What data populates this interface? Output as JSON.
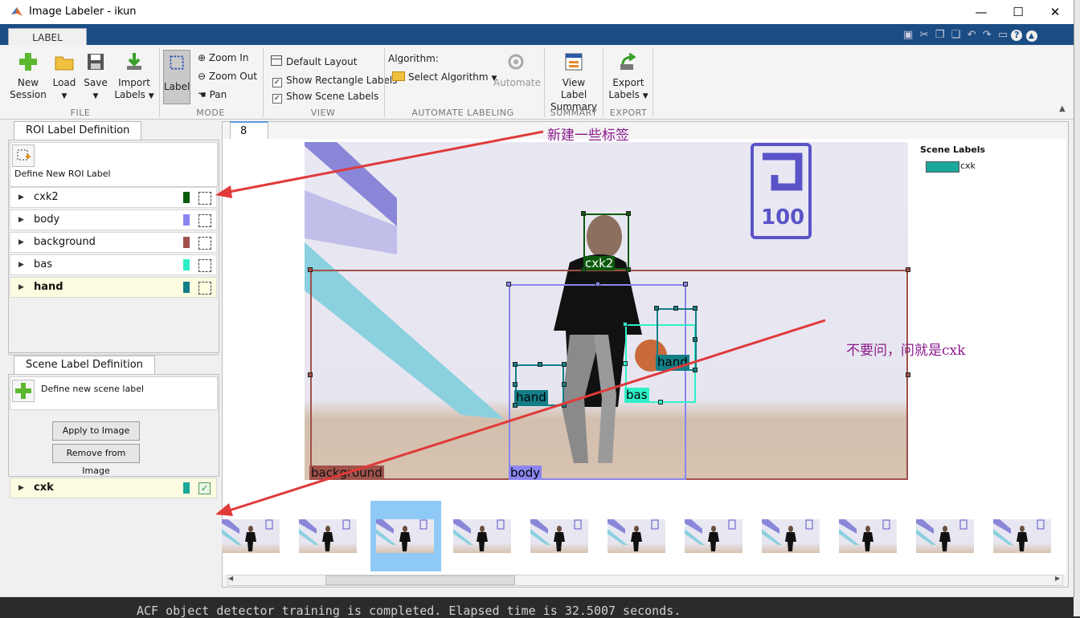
{
  "window": {
    "title": "Image Labeler - ikun",
    "minimize": "—",
    "maximize": "☐",
    "close": "✕"
  },
  "ribbon": {
    "tab": "LABEL",
    "file": {
      "group": "FILE",
      "new_session": [
        "New",
        "Session"
      ],
      "load": "Load",
      "save": "Save",
      "import_labels": [
        "Import",
        "Labels"
      ]
    },
    "mode": {
      "group": "MODE",
      "label": "Label",
      "zoom_in": "Zoom In",
      "zoom_out": "Zoom Out",
      "pan": "Pan"
    },
    "view": {
      "group": "VIEW",
      "default_layout": "Default Layout",
      "show_rect_labels": "Show Rectangle Labels",
      "show_rect_labels_checked": true,
      "show_scene_labels": "Show Scene Labels",
      "show_scene_labels_checked": true
    },
    "automate": {
      "group": "AUTOMATE LABELING",
      "algorithm_label": "Algorithm:",
      "select_algorithm": "Select Algorithm",
      "automate": "Automate"
    },
    "summary": {
      "group": "SUMMARY",
      "view_label_summary": [
        "View Label",
        "Summary"
      ]
    },
    "export": {
      "group": "EXPORT",
      "export_labels": [
        "Export",
        "Labels"
      ]
    }
  },
  "roi_panel": {
    "tab": "ROI Label Definition",
    "define_new": "Define New ROI Label",
    "labels": [
      {
        "name": "cxk2",
        "color": "#0b5a0b",
        "selected": false
      },
      {
        "name": "body",
        "color": "#8a86f0",
        "selected": false
      },
      {
        "name": "background",
        "color": "#a0524a",
        "selected": false
      },
      {
        "name": "bas",
        "color": "#2ef0c8",
        "selected": false
      },
      {
        "name": "hand",
        "color": "#137e86",
        "selected": true
      }
    ]
  },
  "scene_panel": {
    "tab": "Scene Label Definition",
    "define_new": "Define new scene label",
    "apply": "Apply to Image",
    "remove": "Remove from Image",
    "labels": [
      {
        "name": "cxk",
        "color": "#1aa89a",
        "checked": true
      }
    ]
  },
  "image_tab": "8",
  "scene_labels_legend": {
    "title": "Scene Labels",
    "items": [
      {
        "name": "cxk",
        "color": "#1aa89a"
      }
    ]
  },
  "image_text": {
    "logo": "100"
  },
  "boxes": {
    "cxk2": "cxk2",
    "body": "body",
    "background": "background",
    "bas": "bas",
    "hand1": "hand",
    "hand2": "hand"
  },
  "annotations": {
    "top": "新建一些标签",
    "middle": "不要问，问就是cxk",
    "color": "#8b1a8b"
  },
  "filmstrip": {
    "count": 11,
    "selected_index": 2
  },
  "console_line": "ACF object detector training is completed. Elapsed time is 32.5007 seconds."
}
